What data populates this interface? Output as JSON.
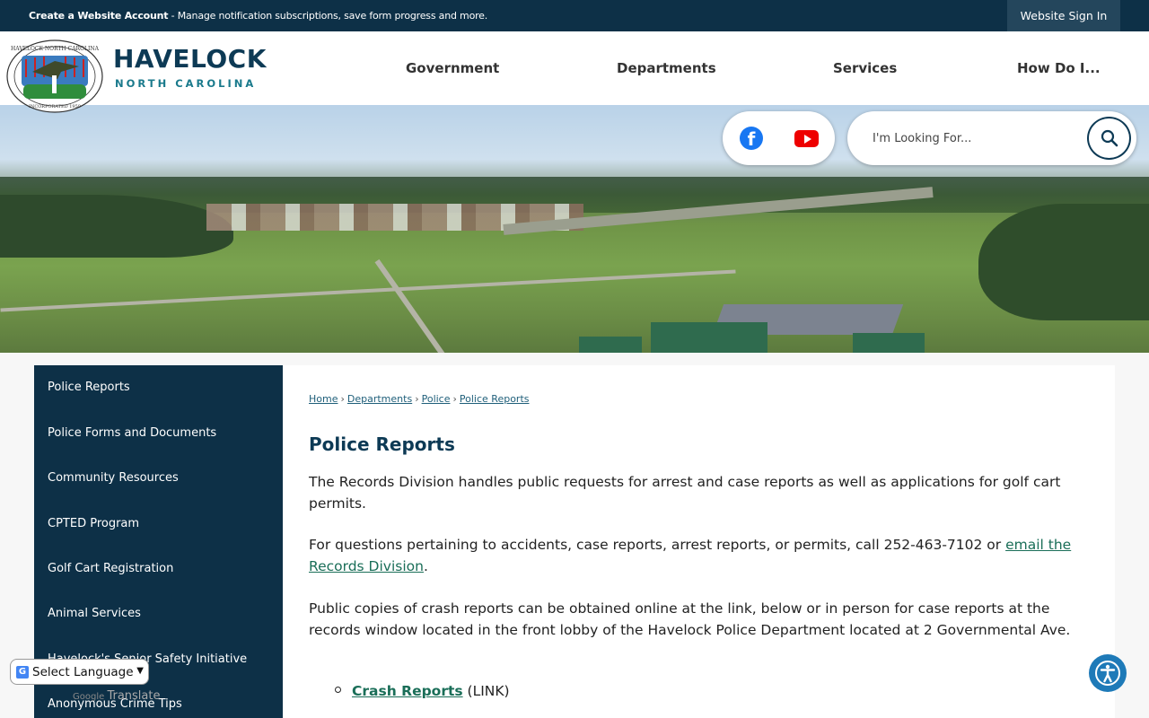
{
  "topbar": {
    "create_account_link": "Create a Website Account",
    "create_account_desc": "- Manage notification subscriptions, save form progress and more.",
    "sign_in": "Website Sign In"
  },
  "brand": {
    "name": "HAVELOCK",
    "subtitle": "NORTH CAROLINA",
    "seal_text_top": "HAVELOCK NORTH CAROLINA",
    "seal_text_bottom": "INCORPORATED 1959"
  },
  "nav": [
    {
      "label": "Government"
    },
    {
      "label": "Departments"
    },
    {
      "label": "Services"
    },
    {
      "label": "How Do I..."
    }
  ],
  "social": {
    "facebook_icon": "facebook-icon",
    "youtube_icon": "youtube-icon"
  },
  "search": {
    "placeholder": "I'm Looking For..."
  },
  "sidebar": {
    "items": [
      {
        "label": "Police Reports"
      },
      {
        "label": "Police Forms and Documents"
      },
      {
        "label": "Community Resources"
      },
      {
        "label": "CPTED Program"
      },
      {
        "label": "Golf Cart Registration"
      },
      {
        "label": "Animal Services"
      },
      {
        "label": "Havelock's Senior Safety Initiative"
      },
      {
        "label": "Anonymous Crime Tips"
      }
    ]
  },
  "breadcrumb": [
    {
      "label": "Home"
    },
    {
      "label": "Departments"
    },
    {
      "label": "Police"
    },
    {
      "label": "Police Reports"
    }
  ],
  "main": {
    "title": "Police Reports",
    "para1": "The Records Division handles public requests for arrest and case reports as well as applications for golf cart permits.",
    "para2_text": "For questions pertaining to accidents, case reports, arrest reports, or permits, call 252-463-7102 or ",
    "para2_link": "email the Records Division",
    "para2_end": ".",
    "para3": "Public copies of crash reports can be obtained online at the link, below or in person for case reports at the records window located in the front lobby of the Havelock Police Department located at 2 Governmental Ave.",
    "list": [
      {
        "link": "Crash Reports",
        "suffix": " (LINK)"
      }
    ]
  },
  "translate": {
    "label": "Select Language",
    "powered_by": "Google",
    "powered_word": "Translate"
  },
  "colors": {
    "navy": "#0d3047",
    "brand_blue": "#0d3a55",
    "teal": "#1a7a8c",
    "link_green": "#1a6e58"
  }
}
